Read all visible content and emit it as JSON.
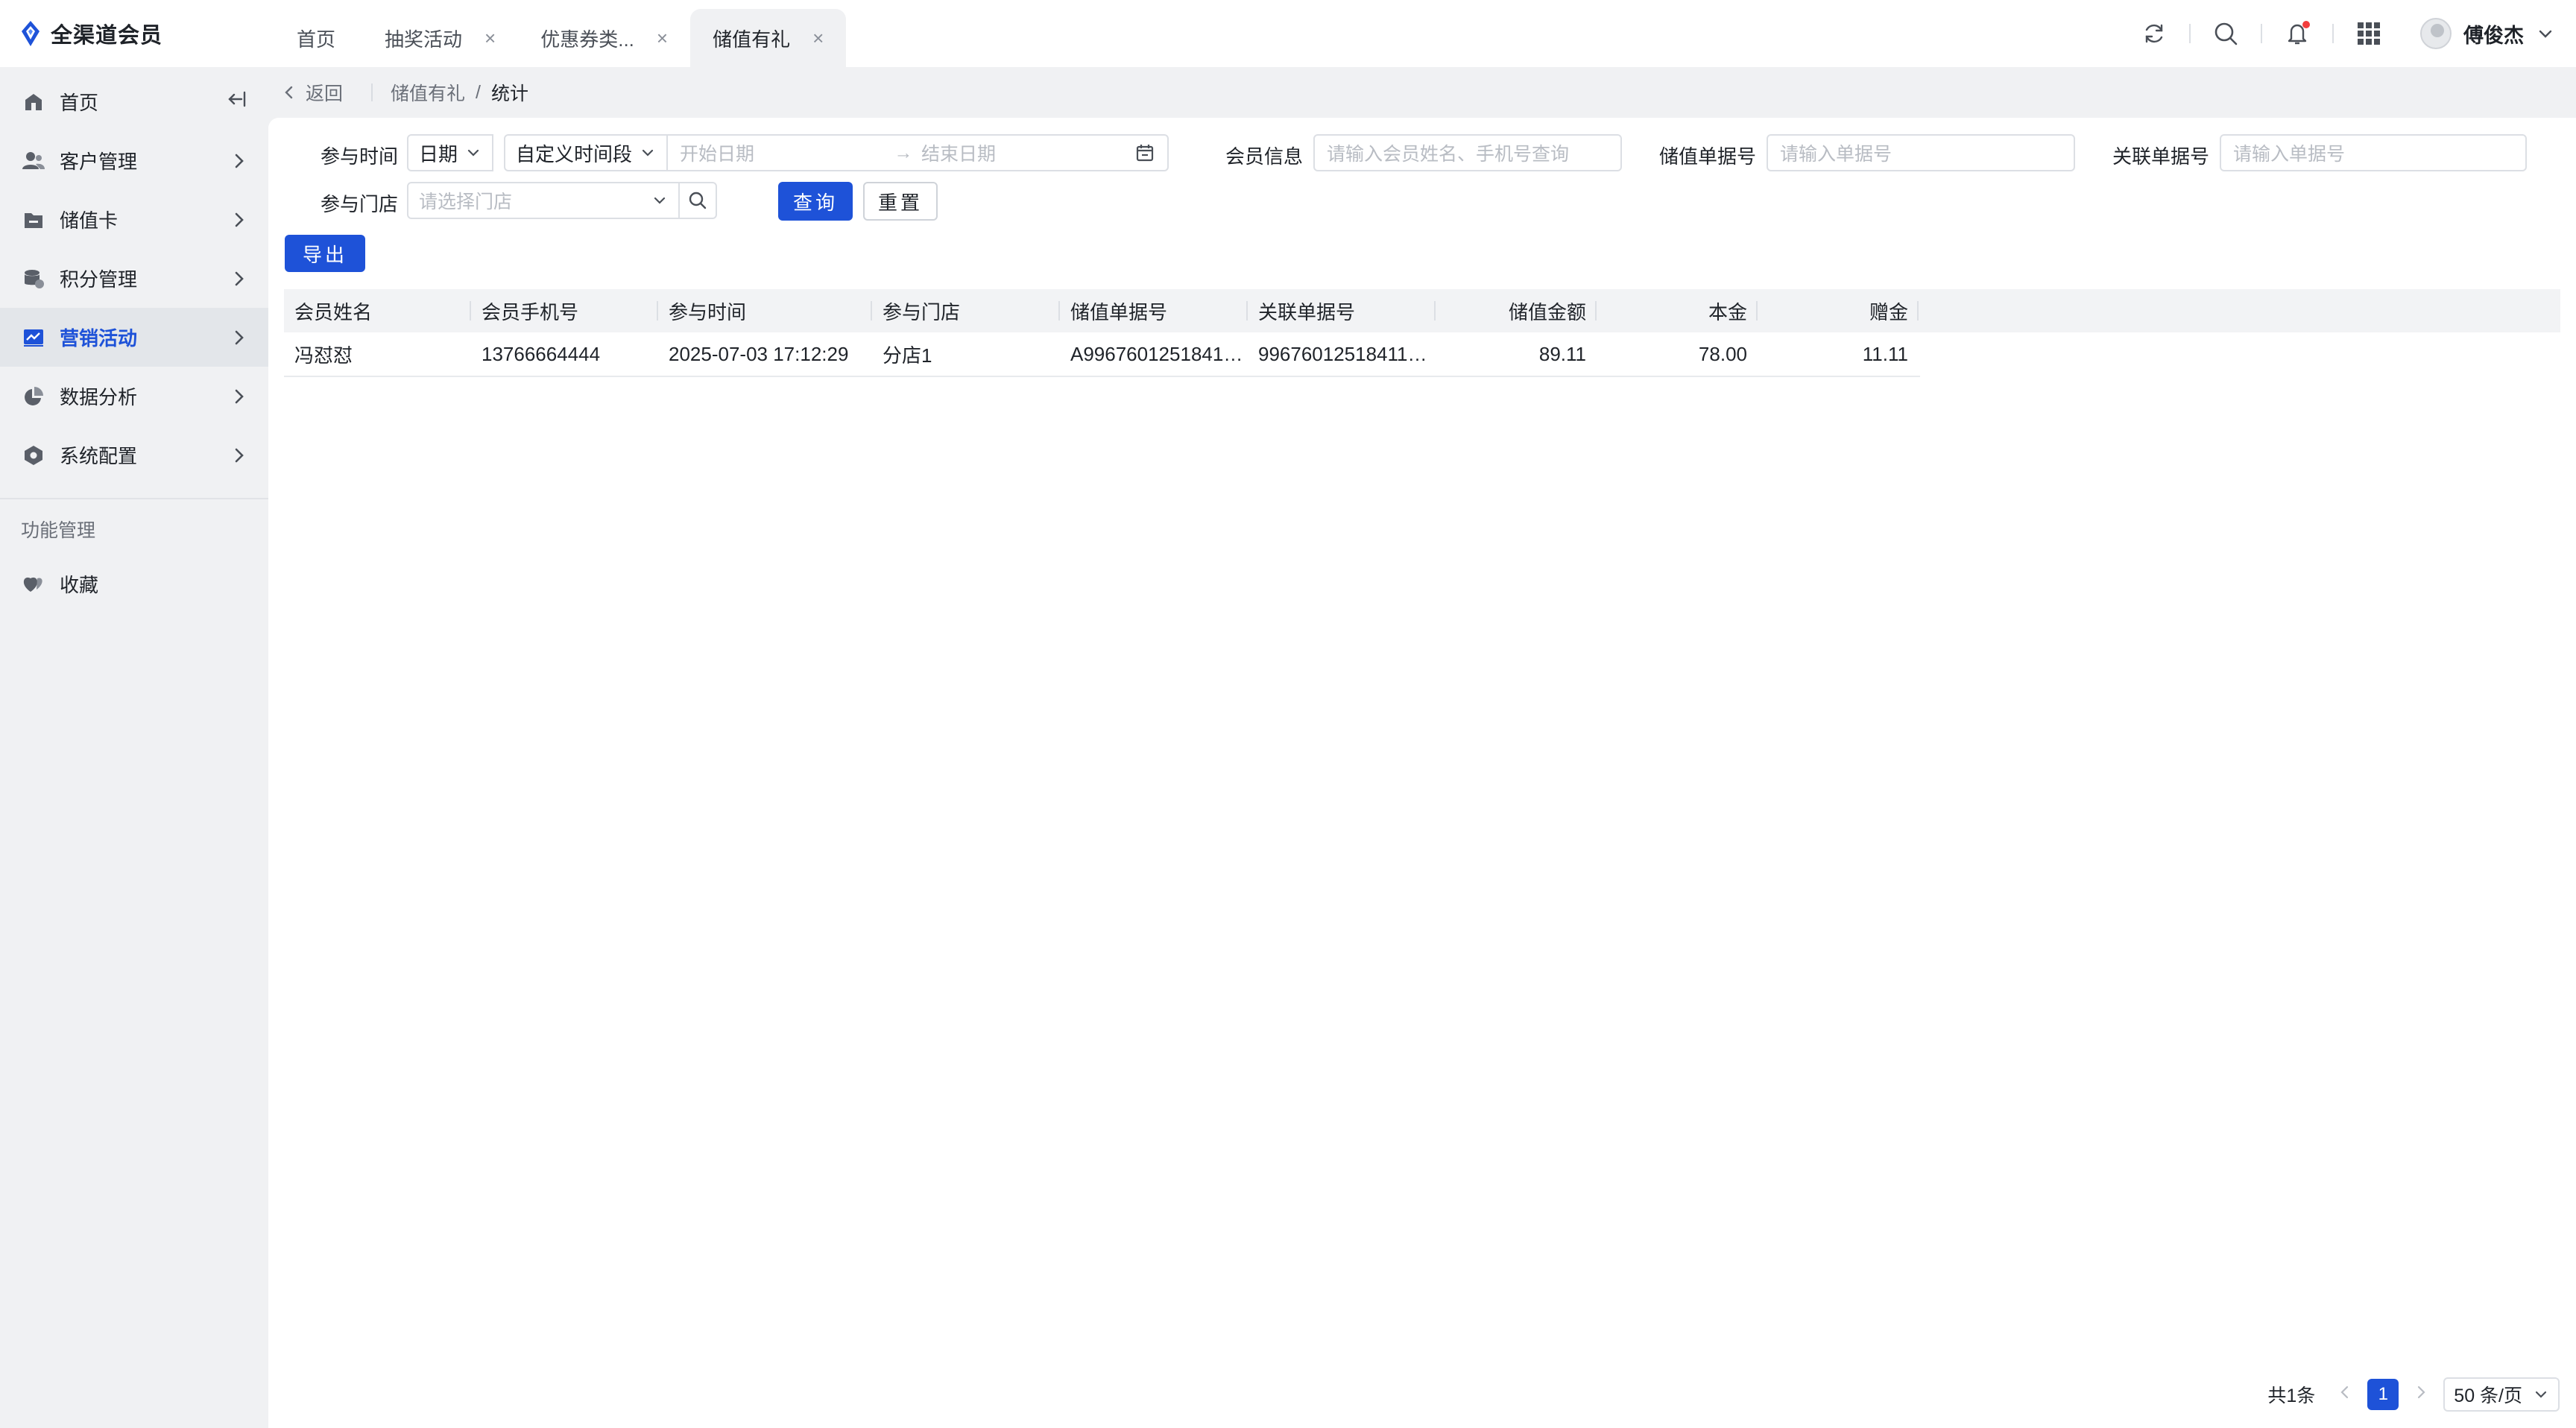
{
  "app": {
    "title": "全渠道会员"
  },
  "tabs": [
    {
      "label": "首页",
      "closable": false
    },
    {
      "label": "抽奖活动",
      "closable": true
    },
    {
      "label": "优惠券类...",
      "closable": true
    },
    {
      "label": "储值有礼",
      "closable": true,
      "active": true
    }
  ],
  "header": {
    "user_name": "傅俊杰",
    "icons": [
      "refresh-icon",
      "search-icon",
      "bell-icon",
      "apps-grid-icon"
    ]
  },
  "sidebar": {
    "items": [
      {
        "label": "首页",
        "icon": "home-icon"
      },
      {
        "label": "客户管理",
        "icon": "users-icon"
      },
      {
        "label": "储值卡",
        "icon": "card-icon"
      },
      {
        "label": "积分管理",
        "icon": "points-icon"
      },
      {
        "label": "营销活动",
        "icon": "marketing-icon",
        "active": true
      },
      {
        "label": "数据分析",
        "icon": "pie-chart-icon"
      },
      {
        "label": "系统配置",
        "icon": "hexagon-settings-icon"
      }
    ],
    "group_title": "功能管理",
    "favorites_label": "收藏"
  },
  "breadcrumb": {
    "back": "返回",
    "parent": "储值有礼",
    "separator": "/",
    "current": "统计"
  },
  "filters": {
    "time_label": "参与时间",
    "time_type": "日期",
    "time_range_type": "自定义时间段",
    "start_placeholder": "开始日期",
    "range_arrow": "→",
    "end_placeholder": "结束日期",
    "member_label": "会员信息",
    "member_placeholder": "请输入会员姓名、手机号查询",
    "order_label": "储值单据号",
    "order_placeholder": "请输入单据号",
    "related_label": "关联单据号",
    "related_placeholder": "请输入单据号",
    "store_label": "参与门店",
    "store_placeholder": "请选择门店",
    "query_button": "查询",
    "reset_button": "重置",
    "export_button": "导出"
  },
  "table": {
    "columns": [
      "会员姓名",
      "会员手机号",
      "参与时间",
      "参与门店",
      "储值单据号",
      "关联单据号",
      "储值金额",
      "本金",
      "赠金"
    ],
    "rows": [
      [
        "冯怼怼",
        "13766664444",
        "2025-07-03 17:12:29",
        "分店1",
        "A9967601251841…",
        "99676012518411…",
        "89.11",
        "78.00",
        "11.11"
      ]
    ]
  },
  "pagination": {
    "total": "共1条",
    "current_page": "1",
    "page_size": "50 条/页"
  },
  "colors": {
    "primary": "#1e52d8",
    "badge": "#f23d3d"
  }
}
